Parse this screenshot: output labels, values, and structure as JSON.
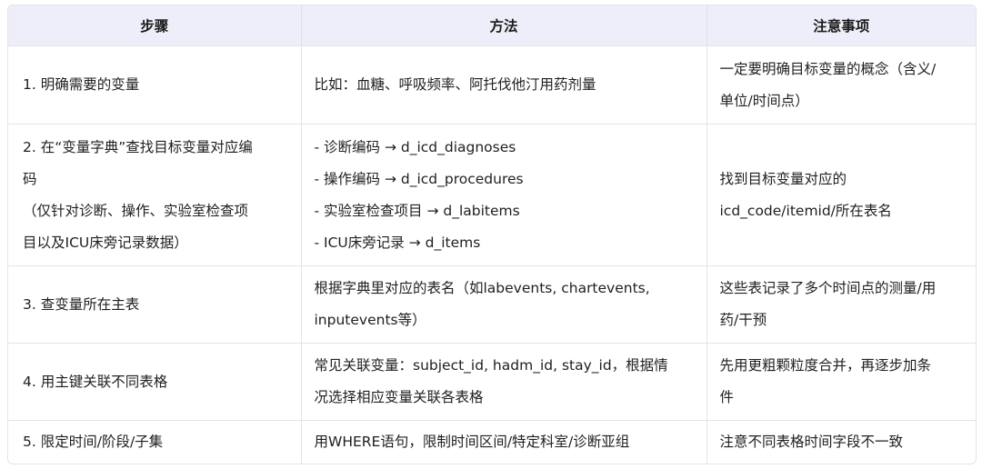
{
  "table": {
    "headers": [
      "步骤",
      "方法",
      "注意事项"
    ],
    "rows": [
      {
        "step": [
          "1. 明确需要的变量"
        ],
        "method": [
          "比如：血糖、呼吸频率、阿托伐他汀用药剂量"
        ],
        "note": [
          "一定要明确目标变量的概念（含义/",
          "单位/时间点）"
        ]
      },
      {
        "step": [
          "2. 在“变量字典”查找目标变量对应编",
          "码",
          "（仅针对诊断、操作、实验室检查项",
          "目以及ICU床旁记录数据）"
        ],
        "method": [
          "- 诊断编码 → d_icd_diagnoses",
          "- 操作编码 → d_icd_procedures",
          "- 实验室检查项目 → d_labitems",
          "- ICU床旁记录 → d_items"
        ],
        "note": [
          "找到目标变量对应的",
          "icd_code/itemid/所在表名"
        ]
      },
      {
        "step": [
          "3. 查变量所在主表"
        ],
        "method": [
          "根据字典里对应的表名（如labevents, chartevents,",
          "inputevents等）"
        ],
        "note": [
          "这些表记录了多个时间点的测量/用",
          "药/干预"
        ]
      },
      {
        "step": [
          "4. 用主键关联不同表格"
        ],
        "method": [
          "常见关联变量：subject_id, hadm_id, stay_id，根据情",
          "况选择相应变量关联各表格"
        ],
        "note": [
          "先用更粗颗粒度合并，再逐步加条",
          "件"
        ]
      },
      {
        "step": [
          "5. 限定时间/阶段/子集"
        ],
        "method": [
          "用WHERE语句，限制时间区间/特定科室/诊断亚组"
        ],
        "note": [
          "注意不同表格时间字段不一致"
        ]
      }
    ]
  }
}
